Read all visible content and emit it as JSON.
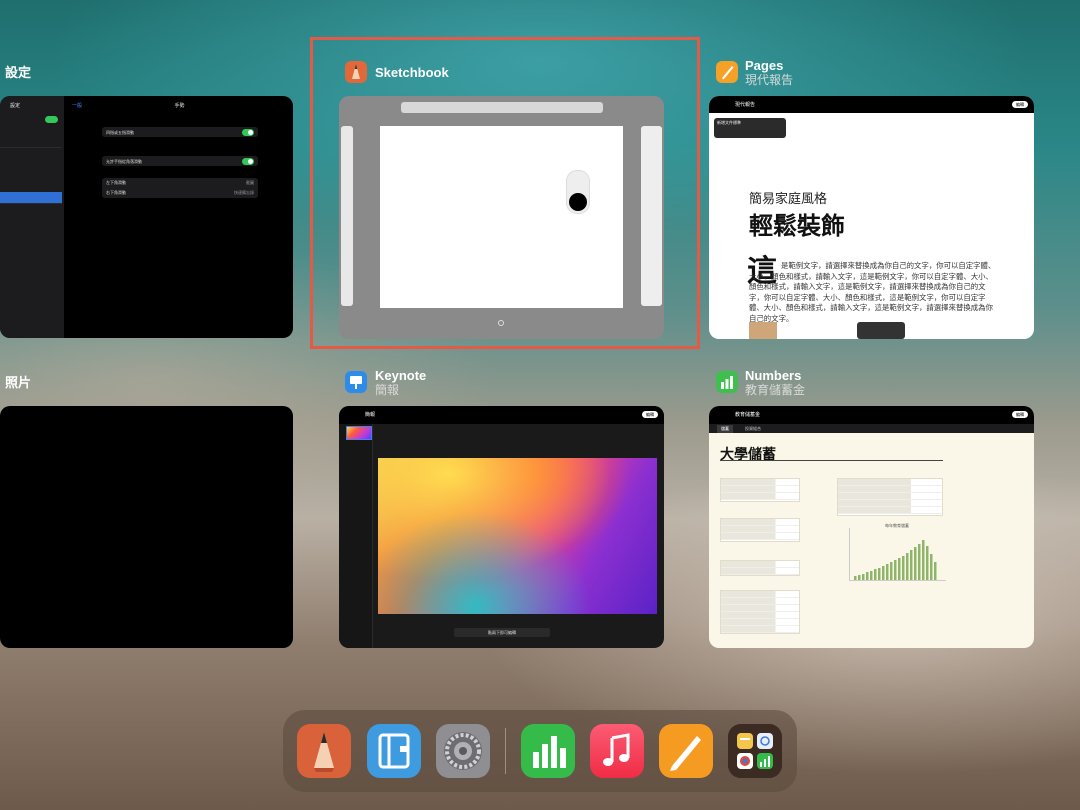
{
  "apps": {
    "settings": {
      "name": "設定"
    },
    "sketchbook": {
      "name": "Sketchbook"
    },
    "pages": {
      "name": "Pages",
      "subtitle": "現代報告"
    },
    "photos": {
      "name": "照片"
    },
    "keynote": {
      "name": "Keynote",
      "subtitle": "簡報"
    },
    "numbers": {
      "name": "Numbers",
      "subtitle": "教育儲蓄金"
    }
  },
  "settings_window": {
    "title": "手勢",
    "back_label": "一般",
    "rows": [
      {
        "label": "四指或五指滑動"
      },
      {
        "label": "允許手指從角落滑動"
      },
      {
        "label": "左下角滑動",
        "value": "截圖"
      },
      {
        "label": "右下角滑動",
        "value": "快速備忘錄"
      }
    ],
    "sidebar_items": [
      "式",
      "用時間",
      "心",
      "示與亮度",
      "與多工處理",
      "庫",
      "H",
      "邊牆",
      "Pencil",
      "ID與密碼",
      "與安全性"
    ]
  },
  "pages_window": {
    "doc_title": "現代報告",
    "tooltip_line1": "新增文件標準",
    "tooltip_line2": "若要加入圖片，請點兩下圖片以選取。",
    "kicker": "簡易家庭風格",
    "headline": "輕鬆裝飾",
    "drop_cap": "這",
    "body": "是範例文字，請選擇來替換成為你自己的文字，你可以自定字體、大小、顏色和樣式，請輸入文字，這是範例文字，你可以自定字體、大小、顏色和樣式，請輸入文字，這是範例文字，請選擇來替換成為你自己的文字，你可以自定字體、大小、顏色和樣式，這是範例文字，你可以自定字體、大小、顏色和樣式，請輸入文字，這是範例文字，請選擇來替換成為你自己的文字。",
    "edit_label": "編輯"
  },
  "keynote_window": {
    "doc_title": "簡報",
    "hint": "點兩下即可編輯",
    "edit_label": "編輯"
  },
  "numbers_window": {
    "doc_title": "教育儲蓄金",
    "tabs": [
      "儲蓄",
      "投資組合"
    ],
    "sheet_title": "大學儲蓄",
    "edit_label": "編輯",
    "chart_caption": "每年教育儲蓄"
  },
  "dock": {
    "items": [
      "Sketchbook",
      "Notebooks",
      "設定",
      "Numbers",
      "Music",
      "Pages",
      "App Library"
    ]
  }
}
